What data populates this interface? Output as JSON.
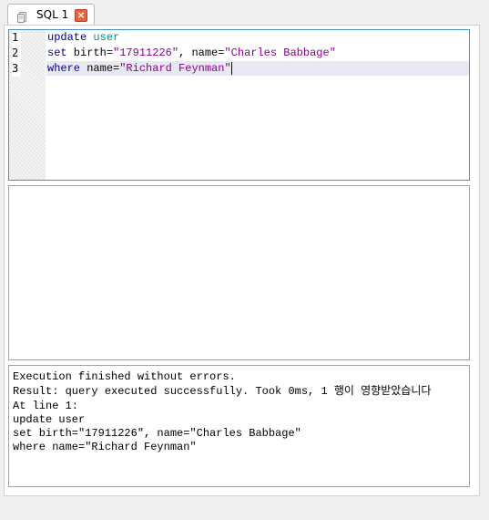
{
  "tab": {
    "label": "SQL 1",
    "close_icon": "close-icon",
    "icon": "sql-document-icon"
  },
  "editor": {
    "line_numbers": [
      "1",
      "2",
      "3"
    ],
    "lines": [
      [
        {
          "text": "update",
          "type": "kw"
        },
        {
          "text": " ",
          "type": "plain"
        },
        {
          "text": "user",
          "type": "ident"
        }
      ],
      [
        {
          "text": "set",
          "type": "kw"
        },
        {
          "text": " birth=",
          "type": "plain"
        },
        {
          "text": "\"17911226\"",
          "type": "str"
        },
        {
          "text": ", name=",
          "type": "plain"
        },
        {
          "text": "\"Charles Babbage\"",
          "type": "str"
        }
      ],
      [
        {
          "text": "where",
          "type": "kw"
        },
        {
          "text": " name=",
          "type": "plain"
        },
        {
          "text": "\"Richard Feynman\"",
          "type": "str"
        }
      ]
    ],
    "colors": {
      "keyword": "#00008b",
      "identifier": "#008b8b",
      "string": "#8b008b",
      "current_line": "#e8e8f2",
      "focus_border": "#4a8fc4"
    }
  },
  "messages": {
    "lines": [
      "Execution finished without errors.",
      "Result: query executed successfully. Took 0ms, 1 행이 영향받았습니다",
      "At line 1:",
      "update user",
      "set birth=\"17911226\", name=\"Charles Babbage\"",
      "where name=\"Richard Feynman\""
    ]
  }
}
